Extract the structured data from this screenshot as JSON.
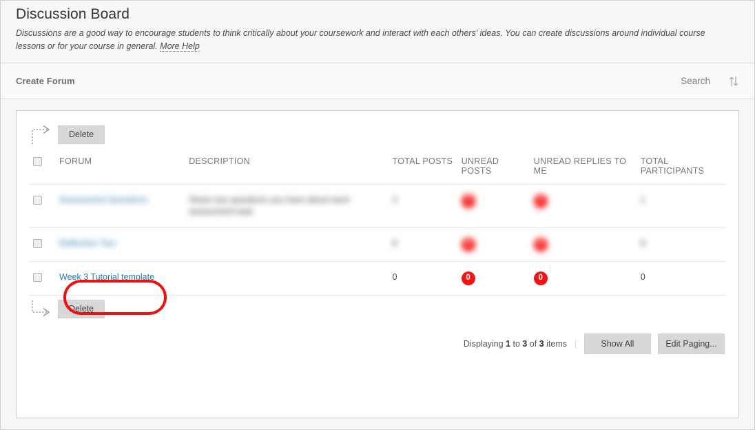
{
  "header": {
    "title": "Discussion Board",
    "description_part1": "Discussions are a good way to encourage students to think critically about your coursework and interact with each others' ideas. You can create discussions around individual course lessons or for your course in general.",
    "more_help": "More Help"
  },
  "action_bar": {
    "create_forum": "Create Forum",
    "search": "Search",
    "sort_icon": "sort-up-down-icon"
  },
  "toolbar": {
    "delete_top": "Delete",
    "delete_bottom": "Delete",
    "arrow_icon": "dashed-arrow-right-icon"
  },
  "table": {
    "columns": [
      {
        "key": "checkbox",
        "label": ""
      },
      {
        "key": "forum",
        "label": "FORUM"
      },
      {
        "key": "description",
        "label": "DESCRIPTION"
      },
      {
        "key": "total_posts",
        "label": "TOTAL POSTS"
      },
      {
        "key": "unread_posts",
        "label": "UNREAD POSTS"
      },
      {
        "key": "unread_replies",
        "label": "UNREAD REPLIES TO ME"
      },
      {
        "key": "total_participants",
        "label": "TOTAL PARTICIPANTS"
      }
    ],
    "rows": [
      {
        "forum": "Assessment Questions",
        "description": "Share any questions you have about each assessment task",
        "total_posts": "3",
        "unread_posts": "3",
        "unread_replies": "3",
        "total_participants": "1",
        "redacted": true,
        "highlighted": false
      },
      {
        "forum": "Reflection Two",
        "description": "",
        "total_posts": "8",
        "unread_posts": "8",
        "unread_replies": "8",
        "total_participants": "8",
        "redacted": true,
        "highlighted": false
      },
      {
        "forum": "Week 3 Tutorial template",
        "description": "",
        "total_posts": "0",
        "unread_posts": "0",
        "unread_replies": "0",
        "total_participants": "0",
        "redacted": false,
        "highlighted": true
      }
    ]
  },
  "paging": {
    "text_prefix": "Displaying ",
    "from": "1",
    "text_mid1": " to ",
    "to": "3",
    "text_mid2": " of ",
    "total": "3",
    "text_suffix": " items",
    "show_all": "Show All",
    "edit_paging": "Edit Paging..."
  },
  "colors": {
    "badge_red": "#f41414",
    "annotation_red": "#ee1111",
    "link_blue": "#2a7ab0"
  }
}
